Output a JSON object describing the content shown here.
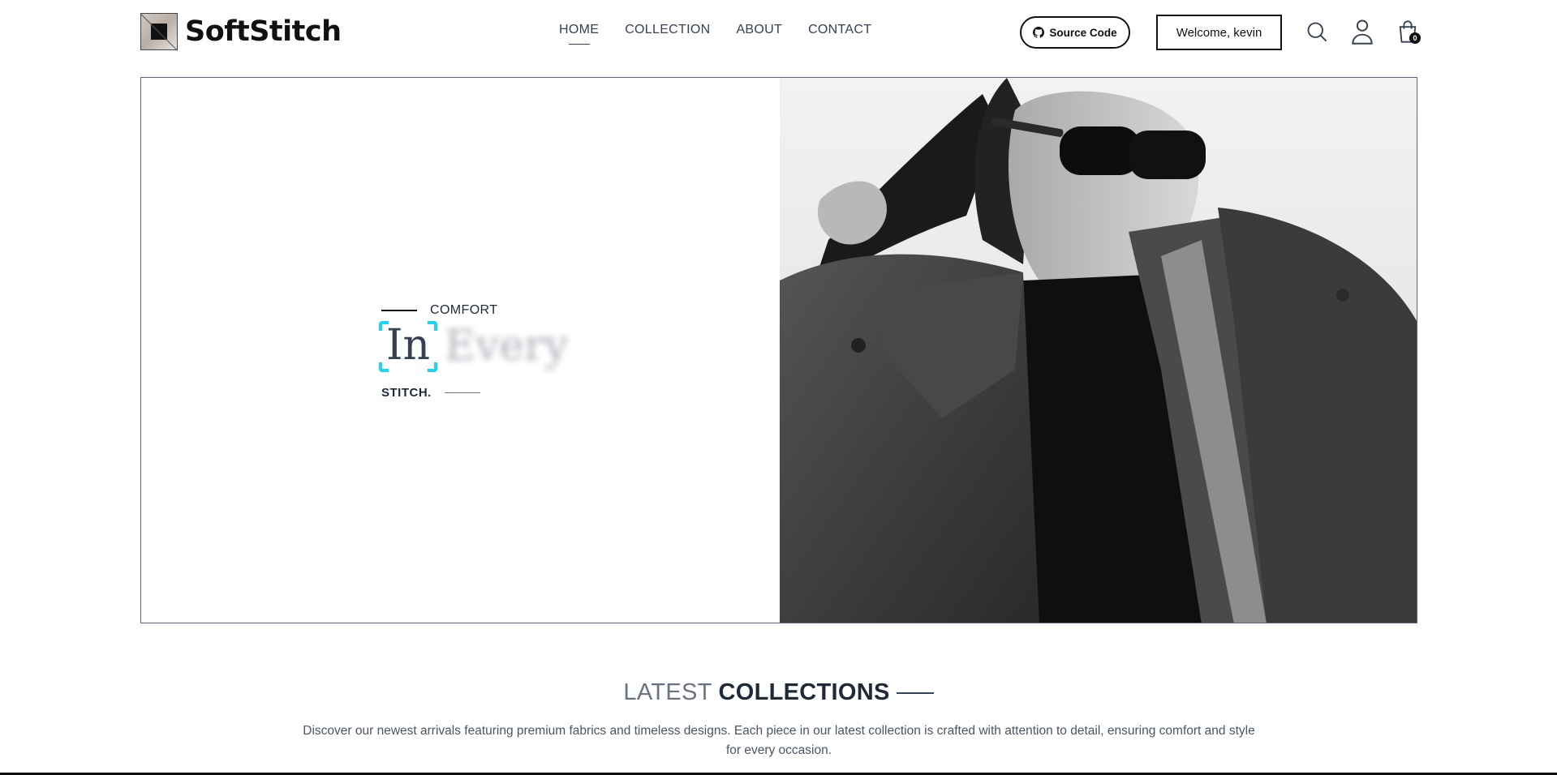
{
  "brand": {
    "name": "SoftStitch"
  },
  "nav": {
    "items": [
      {
        "label": "HOME",
        "active": true
      },
      {
        "label": "COLLECTION",
        "active": false
      },
      {
        "label": "ABOUT",
        "active": false
      },
      {
        "label": "CONTACT",
        "active": false
      }
    ]
  },
  "header": {
    "source_label": "Source Code",
    "welcome_label": "Welcome, kevin",
    "cart_count": "0",
    "icons": [
      "github-icon",
      "search-icon",
      "user-icon",
      "cart-icon"
    ]
  },
  "hero": {
    "tag_top": "COMFORT",
    "word_focus": "In",
    "word_blur": "Every",
    "tag_bottom": "STITCH.",
    "image_description_icon": "model-photo",
    "accent_color": "#22d3ee"
  },
  "latest": {
    "title_light": "LATEST",
    "title_bold": "COLLECTIONS",
    "description": "Discover our newest arrivals featuring premium fabrics and timeless designs. Each piece in our latest collection is crafted with attention to detail, ensuring comfort and style for every occasion."
  }
}
